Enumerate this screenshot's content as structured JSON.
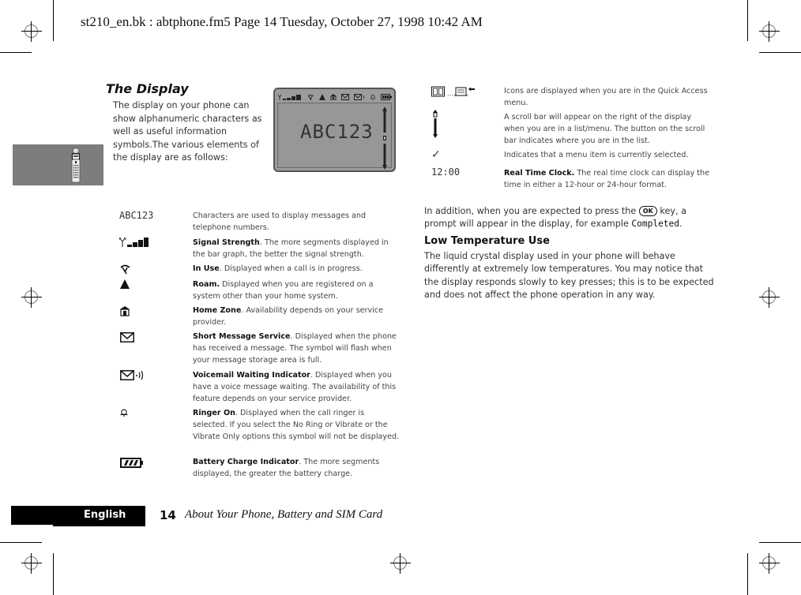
{
  "header": {
    "slug": "st210_en.bk : abtphone.fm5  Page 14  Tuesday, October 27, 1998  10:42 AM"
  },
  "section": {
    "title": "The Display",
    "intro": "The display on your phone can show alphanumeric characters as well as useful information symbols.The various elements of the display are as follows:"
  },
  "lcd": {
    "text": "ABC123",
    "status_icons": [
      "signal-strength-icon",
      "in-use-icon",
      "roam-icon",
      "home-zone-icon",
      "sms-icon",
      "voicemail-icon",
      "ringer-icon",
      "battery-icon"
    ]
  },
  "left_table": [
    {
      "icon": "characters",
      "symbol": "ABC123",
      "bold": "",
      "text": "Characters are used to display messages and telephone numbers."
    },
    {
      "icon": "signal-strength-icon",
      "symbol": "",
      "bold": "Signal Strength",
      "text": ". The more segments displayed in the bar graph, the better the signal strength."
    },
    {
      "icon": "in-use-icon",
      "symbol": "",
      "bold": "In Use",
      "text": ". Displayed when a call is in progress."
    },
    {
      "icon": "roam-icon",
      "symbol": "▲",
      "bold": "Roam.",
      "text": " Displayed when you are registered on a system other than your home system."
    },
    {
      "icon": "home-zone-icon",
      "symbol": "",
      "bold": "Home Zone",
      "text": ". Availability depends on your service provider."
    },
    {
      "icon": "sms-icon",
      "symbol": "",
      "bold": "Short Message Service",
      "text": ". Displayed when the phone has received a message. The symbol will flash when your message storage area is full."
    },
    {
      "icon": "voicemail-icon",
      "symbol": "",
      "bold": "Voicemail Waiting Indicator",
      "text": ". Displayed when you have a voice message waiting. The availability of this feature depends on your service provider."
    },
    {
      "icon": "ringer-icon",
      "symbol": "",
      "bold": "Ringer On",
      "text": ". Displayed when the call ringer is selected. If you select the No Ring or Vibrate or the Vibrate Only options this symbol will not be displayed."
    },
    {
      "icon": "battery-icon",
      "symbol": "",
      "bold": "Battery Charge Indicator",
      "text": ". The more segments displayed, the greater the battery charge."
    }
  ],
  "right_table": [
    {
      "icon": "quick-access-icons",
      "symbol": "...",
      "bold": "",
      "text": "Icons are displayed when you are in the Quick Access menu."
    },
    {
      "icon": "scroll-bar-icon",
      "symbol": "",
      "bold": "",
      "text": "A scroll bar will appear on the right of the display when you are in a list/menu. The button on the scroll bar indicates where you are in the list."
    },
    {
      "icon": "checkmark-icon",
      "symbol": "✓",
      "bold": "",
      "text": "Indicates that a menu item is currently selected."
    },
    {
      "icon": "clock",
      "symbol": "12:00",
      "bold": "Real Time Clock.",
      "text": " The real time clock can display the time in either a 12-hour or 24-hour format."
    }
  ],
  "ok_paragraph": {
    "before": "In addition, when you are expected to press the ",
    "key": "OK",
    "middle": " key, a prompt will appear in the display, for example ",
    "example": "Completed",
    "after": "."
  },
  "low_temp": {
    "title": "Low Temperature Use",
    "text": "The liquid crystal display used in your phone will behave differently at extremely low temperatures. You may notice that the display responds slowly to key presses; this is to be expected and does not affect the phone operation in any way."
  },
  "footer": {
    "language": "English",
    "page_number": "14",
    "chapter": "About Your Phone, Battery and SIM Card"
  }
}
